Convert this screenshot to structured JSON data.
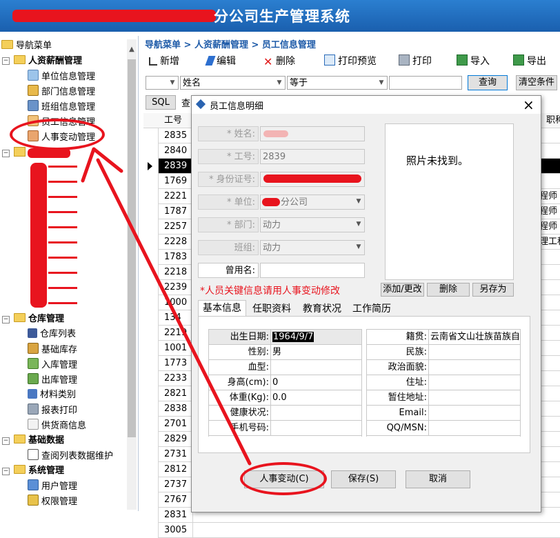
{
  "app": {
    "title_visible": "分公司生产管理系统"
  },
  "nav": {
    "root": "导航菜单",
    "hr_group": "人资薪酬管理",
    "hr_items": [
      "单位信息管理",
      "部门信息管理",
      "班组信息管理",
      "员工信息管理",
      "人事变动管理"
    ],
    "warehouse_group": "仓库管理",
    "warehouse_items": [
      "仓库列表",
      "基础库存",
      "入库管理",
      "出库管理",
      "材料类别",
      "报表打印",
      "供货商信息"
    ],
    "basic_group": "基础数据",
    "basic_items": [
      "查阅列表数据维护"
    ],
    "system_group": "系统管理",
    "system_items": [
      "用户管理",
      "权限管理"
    ]
  },
  "breadcrumb": "导航菜单 > 人资薪酬管理 > 员工信息管理",
  "toolbar": [
    "新增",
    "编辑",
    "删除",
    "打印预览",
    "打印",
    "导入",
    "导出"
  ],
  "filter": {
    "field": "姓名",
    "operator": "等于",
    "value": "",
    "query_btn": "查询",
    "clear_btn": "清空条件",
    "sql_btn": "SQL",
    "sql_partial": "查"
  },
  "grid": {
    "col_header_id": "工号",
    "col_header_title": "职称",
    "ids": [
      "2835",
      "2840",
      "2839",
      "1769",
      "2221",
      "1787",
      "2257",
      "2228",
      "1783",
      "2218",
      "2239",
      "1000",
      "134",
      "2219",
      "1001",
      "1773",
      "2233",
      "2821",
      "2838",
      "2701",
      "2829",
      "2731",
      "2812",
      "2737",
      "2767",
      "2831",
      "3005"
    ],
    "right_partials": {
      "4": "程师",
      "5": "程师",
      "6": "程师",
      "7": "理工程"
    }
  },
  "dialog": {
    "title": "员工信息明细",
    "close_icon": "×",
    "labels": {
      "name": "* 姓名:",
      "id": "* 工号:",
      "idcard": "* 身份证号:",
      "unit": "* 单位:",
      "dept": "* 部门:",
      "team": "班组:",
      "former_name": "曾用名:"
    },
    "values": {
      "name": "",
      "id": "2839",
      "unit": "分公司",
      "dept": "动力",
      "team": "动力",
      "former_name": ""
    },
    "photo_text": "照片未找到。",
    "warning": "*人员关键信息请用人事变动修改",
    "photo_buttons": [
      "添加/更改",
      "删除",
      "另存为"
    ],
    "tabs": [
      "基本信息",
      "任职资料",
      "教育状况",
      "工作简历"
    ],
    "left_rows": [
      {
        "label": "出生日期:",
        "value": "1964/9/7"
      },
      {
        "label": "性别:",
        "value": "男"
      },
      {
        "label": "血型:",
        "value": ""
      },
      {
        "label": "身高(cm):",
        "value": "0"
      },
      {
        "label": "体重(Kg):",
        "value": "0.0"
      },
      {
        "label": "健康状况:",
        "value": ""
      },
      {
        "label": "手机号码:",
        "value": ""
      }
    ],
    "right_rows": [
      {
        "label": "籍贯:",
        "value": "云南省文山壮族苗族自"
      },
      {
        "label": "民族:",
        "value": ""
      },
      {
        "label": "政治面貌:",
        "value": ""
      },
      {
        "label": "住址:",
        "value": ""
      },
      {
        "label": "暂住地址:",
        "value": ""
      },
      {
        "label": "Email:",
        "value": ""
      },
      {
        "label": "QQ/MSN:",
        "value": ""
      }
    ],
    "bottom_buttons": [
      "人事变动(C)",
      "保存(S)",
      "取消"
    ]
  },
  "accent": {
    "annotation_red": "#e8141e",
    "titlebar_blue": "#1a5fae",
    "selected_row": "#000000"
  }
}
